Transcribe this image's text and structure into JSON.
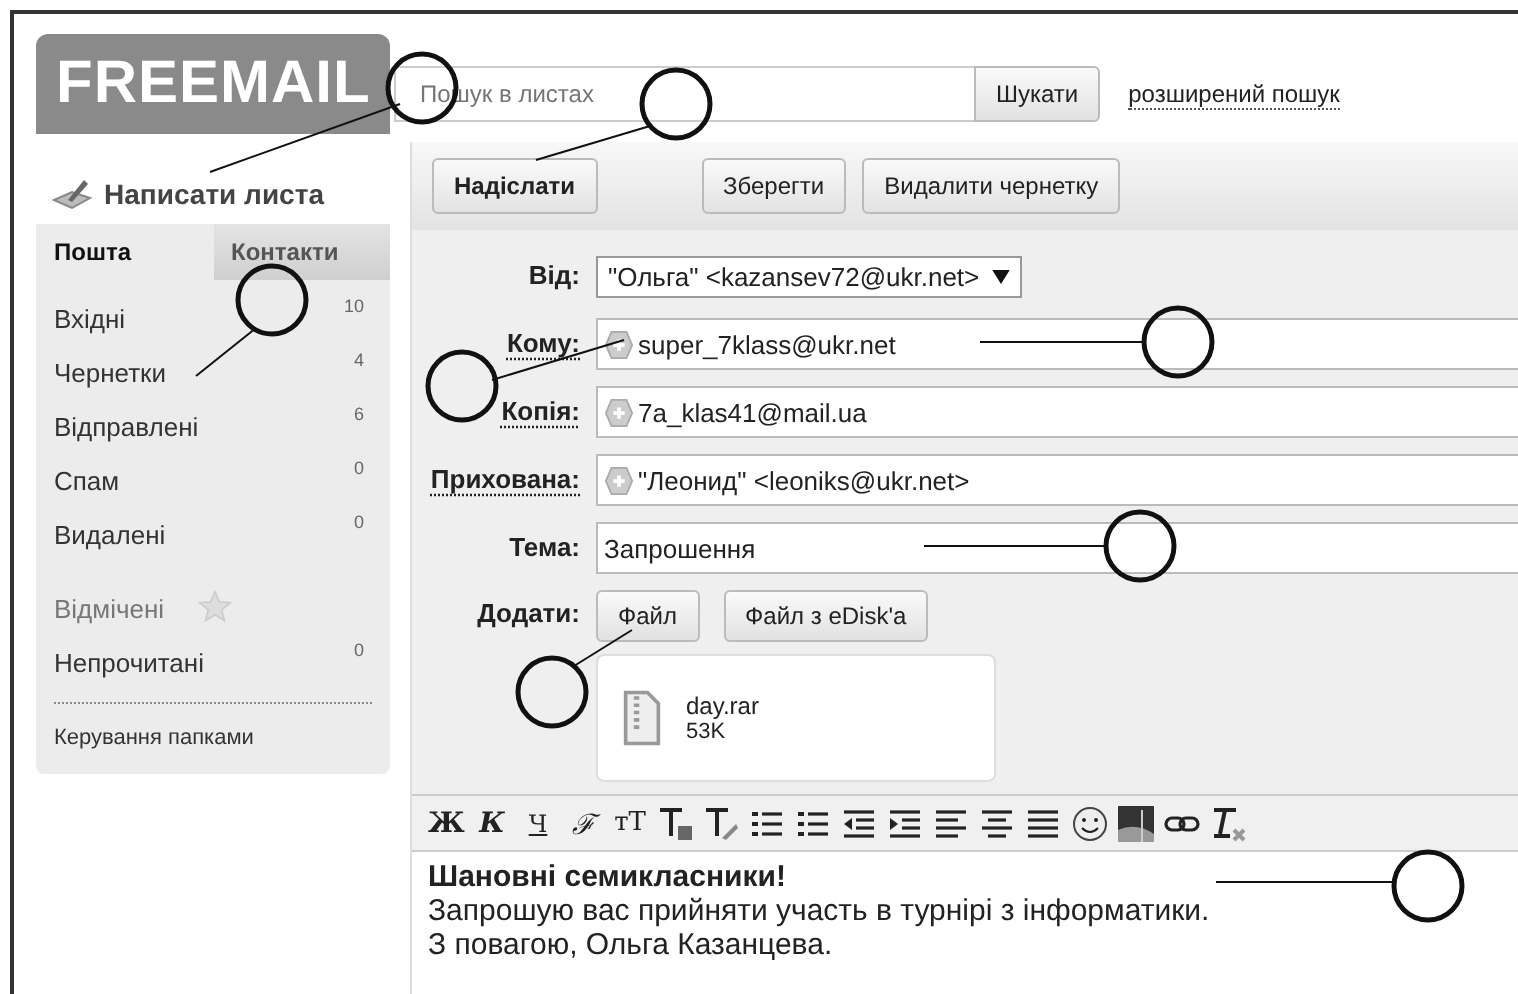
{
  "logo": "FREEMAIL",
  "search": {
    "placeholder": "Пошук в листах",
    "button": "Шукати",
    "advanced_link": "розширений пошук"
  },
  "compose_link": "Написати листа",
  "tabs": [
    {
      "label": "Пошта",
      "selected": true
    },
    {
      "label": "Контакти",
      "selected": false
    }
  ],
  "folders": [
    {
      "name": "Вхідні",
      "count": "10"
    },
    {
      "name": "Чернетки",
      "count": "4"
    },
    {
      "name": "Відправлені",
      "count": "6"
    },
    {
      "name": "Спам",
      "count": "0"
    },
    {
      "name": "Видалені",
      "count": "0"
    }
  ],
  "filters": [
    {
      "name": "Відмічені",
      "kind": "starred"
    },
    {
      "name": "Непрочитані",
      "kind": "count",
      "count": "0"
    }
  ],
  "manage_folders": "Керування папками",
  "actions": [
    {
      "label": "Надіслати",
      "primary": true
    },
    {
      "label": "Зберегти",
      "primary": false
    },
    {
      "label": "Видалити чернетку",
      "primary": false
    }
  ],
  "form": [
    {
      "label": "Від:",
      "kind": "select",
      "value": "\"Ольга\" <kazansev72@ukr.net>"
    },
    {
      "label": "Кому:",
      "kind": "recipient",
      "value": "super_7klass@ukr.net"
    },
    {
      "label": "Копія:",
      "kind": "recipient",
      "value": "7a_klas41@mail.ua"
    },
    {
      "label": "Прихована:",
      "kind": "recipient",
      "value": "\"Леонид\" <leoniks@ukr.net>"
    },
    {
      "label": "Тема:",
      "kind": "text",
      "value": "Запрошення"
    }
  ],
  "attach": {
    "label": "Додати:",
    "buttons": [
      "Файл",
      "Файл з eDisk'a"
    ],
    "file": {
      "name": "day.rar",
      "size": "53K"
    }
  },
  "editor_toolbar": [
    {
      "kind": "bold",
      "label": "Ж"
    },
    {
      "kind": "italic",
      "label": "К"
    },
    {
      "kind": "underline",
      "label": "Ч"
    },
    {
      "kind": "font",
      "label": "ℱ"
    },
    {
      "kind": "size",
      "label": "тТ"
    },
    {
      "kind": "text-color"
    },
    {
      "kind": "background-color"
    },
    {
      "kind": "ordered-list"
    },
    {
      "kind": "bullet-list"
    },
    {
      "kind": "outdent"
    },
    {
      "kind": "indent"
    },
    {
      "kind": "align-left"
    },
    {
      "kind": "align-center"
    },
    {
      "kind": "align-justify"
    },
    {
      "kind": "smiley"
    },
    {
      "kind": "image"
    },
    {
      "kind": "link"
    },
    {
      "kind": "clear-format"
    }
  ],
  "body": [
    "Шановні семикласники!",
    "Запрошую вас прийняти участь в турнірі з інформатики.",
    "З повагою, Ольга Казанцева."
  ]
}
